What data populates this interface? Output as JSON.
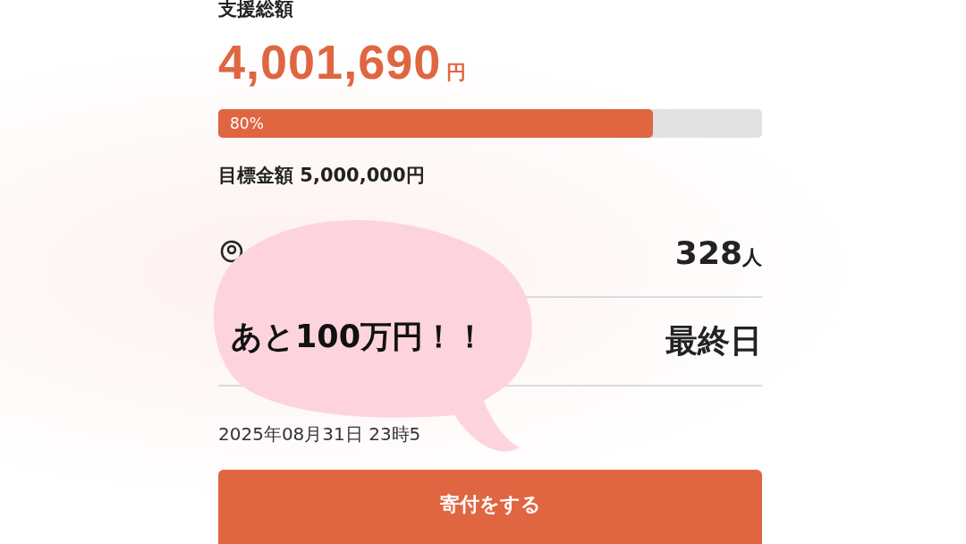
{
  "funding": {
    "label": "支援総額",
    "amount": "4,001,690",
    "currency": "円",
    "progress": {
      "level": 0.8,
      "label": "80%"
    },
    "goal": "目標金額 5,000,000円"
  },
  "stats": [
    {
      "kind": "supporters",
      "value": "328",
      "unit": "人"
    },
    {
      "kind": "remaining",
      "value": "最終日"
    }
  ],
  "deadline": "2025年08月31日 23時5",
  "donate_button": "寄付をする",
  "callout": "あと100万円！！"
}
